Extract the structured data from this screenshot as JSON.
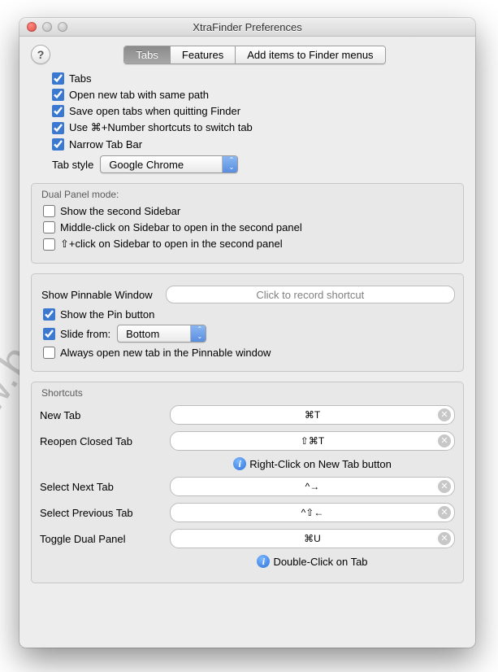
{
  "window_title": "XtraFinder Preferences",
  "tabs": {
    "t0": "Tabs",
    "t1": "Features",
    "t2": "Add items to Finder menus"
  },
  "main": {
    "c0": "Tabs",
    "c1": "Open new tab with same path",
    "c2": "Save open tabs when quitting Finder",
    "c3": "Use ⌘+Number shortcuts to switch tab",
    "c4": "Narrow Tab Bar",
    "tab_style_label": "Tab style",
    "tab_style_value": "Google Chrome"
  },
  "dual": {
    "title": "Dual Panel mode:",
    "c0": "Show the second Sidebar",
    "c1": "Middle-click on Sidebar to open in the second panel",
    "c2": "⇧+click on Sidebar to open in the second panel"
  },
  "pinnable": {
    "show_label": "Show Pinnable Window",
    "record_placeholder": "Click to record shortcut",
    "c_show_pin": "Show the Pin button",
    "slide_label": "Slide from:",
    "slide_value": "Bottom",
    "c_always": "Always open new tab in the Pinnable window"
  },
  "shortcuts": {
    "title": "Shortcuts",
    "s0": {
      "label": "New Tab",
      "value": "⌘T"
    },
    "s1": {
      "label": "Reopen Closed Tab",
      "value": "⇧⌘T"
    },
    "hint1": "Right-Click on New Tab button",
    "s2": {
      "label": "Select Next Tab",
      "value": "^→"
    },
    "s3": {
      "label": "Select Previous Tab",
      "value": "^⇧←"
    },
    "s4": {
      "label": "Toggle Dual Panel",
      "value": "⌘U"
    },
    "hint2": "Double-Click on Tab"
  },
  "watermark": "www.best-mac-tips.com"
}
